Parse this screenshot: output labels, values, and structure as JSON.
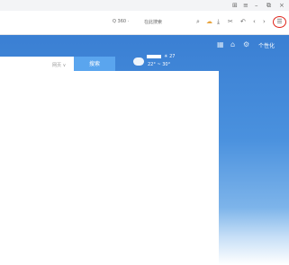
{
  "window": {
    "controls": {
      "skin": "⊞",
      "menu": "≡",
      "minimize": "–",
      "restore": "⧉",
      "close": "×"
    }
  },
  "toolbar": {
    "search_engine": "Q 360 ·",
    "bookmark": "在此搜索",
    "icons": [
      "search-icon",
      "weather-cloud-icon",
      "download-icon",
      "cut-icon",
      "undo-icon",
      "back-icon",
      "forward-icon"
    ],
    "menu_glyph": "☰",
    "menu_highlight_color": "#e0251b"
  },
  "header": {
    "login": "个性化"
  },
  "search": {
    "select_label": "网页 ∨",
    "button_label": "搜索"
  },
  "weather": {
    "now": "☀ 27",
    "range": "22° ~ 30°"
  },
  "colors": {
    "brand_blue": "#3a7fd3",
    "search_button": "#5aa5ee"
  }
}
